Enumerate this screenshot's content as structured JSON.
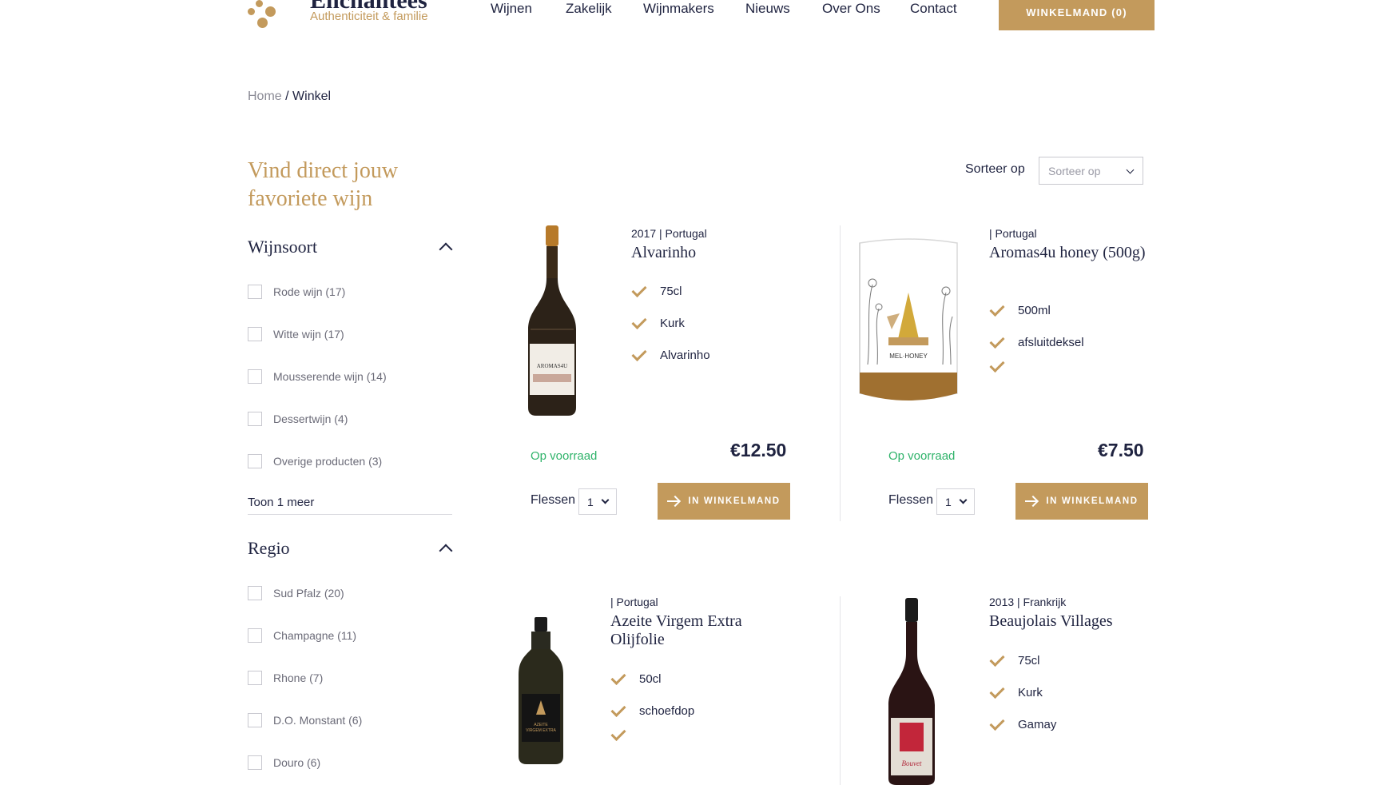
{
  "header": {
    "logo_title": "Enchantées",
    "logo_subtitle": "Authenticiteit & familie",
    "nav": [
      "Wijnen",
      "Zakelijk",
      "Wijnmakers",
      "Nieuws",
      "Over Ons",
      "Contact"
    ],
    "cart_label": "WINKELMAND (0)"
  },
  "breadcrumb": {
    "home": "Home",
    "separator": "/",
    "current": "Winkel"
  },
  "sidebar": {
    "title": "Vind direct jouw favoriete wijn",
    "wijnsoort": {
      "title": "Wijnsoort",
      "options": [
        "Rode wijn (17)",
        "Witte wijn (17)",
        "Mousserende wijn (14)",
        "Dessertwijn (4)",
        "Overige producten (3)"
      ],
      "show_more": "Toon 1 meer"
    },
    "regio": {
      "title": "Regio",
      "options": [
        "Sud Pfalz (20)",
        "Champagne (11)",
        "Rhone (7)",
        "D.O. Monstant (6)",
        "Douro (6)"
      ]
    }
  },
  "sort": {
    "label": "Sorteer op",
    "selected": "Sorteer op"
  },
  "products": [
    {
      "meta": "2017 | Portugal",
      "name": "Alvarinho",
      "features": [
        "75cl",
        "Kurk",
        "Alvarinho"
      ],
      "stock": "Op voorraad",
      "price": "€12.50",
      "qty_label": "Flessen",
      "qty": "1",
      "button": "IN WINKELMAND"
    },
    {
      "meta": "| Portugal",
      "name": "Aromas4u honey (500g)",
      "features": [
        "500ml",
        "afsluitdeksel",
        ""
      ],
      "stock": "Op voorraad",
      "price": "€7.50",
      "qty_label": "Flessen",
      "qty": "1",
      "button": "IN WINKELMAND"
    },
    {
      "meta": "| Portugal",
      "name": "Azeite Virgem Extra Olijfolie",
      "features": [
        "50cl",
        "schoefdop",
        ""
      ]
    },
    {
      "meta": "2013 | Frankrijk",
      "name": "Beaujolais Villages",
      "features": [
        "75cl",
        "Kurk",
        "Gamay"
      ]
    }
  ],
  "colors": {
    "accent": "#c39a5c",
    "text": "#1f2340",
    "stock": "#2fb36a"
  }
}
